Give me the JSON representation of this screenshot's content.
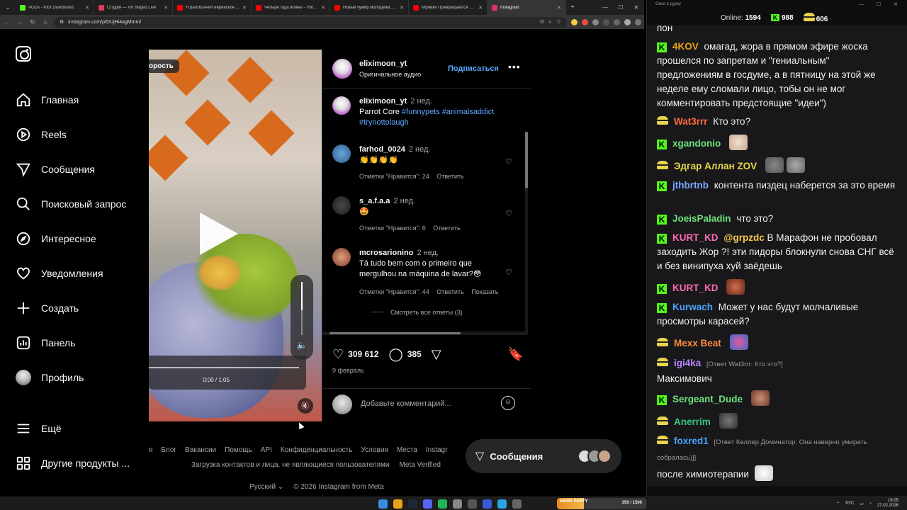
{
  "browser": {
    "tabs": [
      {
        "label": "VODs - Kick Dashboard",
        "color": "#53fc18",
        "active": false
      },
      {
        "label": "Студия — VK Видео Live",
        "color": "#e03a5c",
        "active": false
      },
      {
        "label": "Я разоблачил еврейское ...",
        "color": "#ff0000",
        "active": false
      },
      {
        "label": "Четыре года войны - YouTube",
        "color": "#ff0000",
        "active": false
      },
      {
        "label": "Новый кумир молодежи, ...",
        "color": "#ff0000",
        "active": false
      },
      {
        "label": "Мужики Превращаются в ...",
        "color": "#ff0000",
        "active": false
      },
      {
        "label": "Instagram",
        "color": "#e1306c",
        "active": true
      }
    ],
    "url": "instagram.com/p/DUjHi4agMmm/"
  },
  "ig_nav": {
    "items": [
      {
        "label": "Главная",
        "icon": "home-icon"
      },
      {
        "label": "Reels",
        "icon": "reels-icon"
      },
      {
        "label": "Сообщения",
        "icon": "messages-icon"
      },
      {
        "label": "Поисковый запрос",
        "icon": "search-icon"
      },
      {
        "label": "Интересное",
        "icon": "compass-icon"
      },
      {
        "label": "Уведомления",
        "icon": "heart-icon"
      },
      {
        "label": "Создать",
        "icon": "plus-icon"
      },
      {
        "label": "Панель",
        "icon": "dashboard-icon"
      },
      {
        "label": "Профиль",
        "icon": "avatar"
      }
    ],
    "more": "Ещё",
    "other_products": "Другие продукты ..."
  },
  "video": {
    "label": "орость",
    "time": "0:00 / 1:05"
  },
  "post": {
    "username": "eliximoon_yt",
    "audio": "Оригинальное аудио",
    "follow": "Подписаться",
    "more": "•••",
    "caption": {
      "username": "eliximoon_yt",
      "time": "2 нед.",
      "text": "Parrot Core",
      "tags": "#funnypets #animalsaddict #trynottolaugh"
    },
    "comments": [
      {
        "username": "farhod_0024",
        "time": "2 нед.",
        "text": "👏👏👏👏",
        "likes": "Отметки \"Нравится\": 24",
        "reply": "Ответить",
        "extra": ""
      },
      {
        "username": "s_a.f.a.a",
        "time": "2 нед.",
        "text": "🤩",
        "likes": "Отметки \"Нравится\": 6",
        "reply": "Ответить",
        "extra": ""
      },
      {
        "username": "mcrosarionino",
        "time": "2 нед.",
        "text": "Tá tudo bem com o primeiro que mergulhou na máquina de lavar?😳",
        "likes": "Отметки \"Нравится\": 44",
        "reply": "Ответить",
        "extra": "Показать"
      }
    ],
    "view_replies": "Смотреть все ответы (3)",
    "like_count": "309 612",
    "comment_count": "385",
    "date": "9 февраль",
    "add_comment_placeholder": "Добавьте комментарий..."
  },
  "footer": {
    "links": [
      "я",
      "Блог",
      "Вакансии",
      "Помощь",
      "API",
      "Конфиденциальность",
      "Условия",
      "Места",
      "Instagr"
    ],
    "links2": [
      "Загрузка контактов и лица, не являющиеся пользователями",
      "Meta Verified"
    ],
    "language": "Русский",
    "copyright": "© 2026 Instagram from Meta"
  },
  "messages_pill": {
    "label": "Сообщения"
  },
  "chat": {
    "window_title": "Окно в дурку",
    "online_label": "Online:",
    "online_count": "1594",
    "kick_count": "988",
    "twitch_count": "606",
    "messages": [
      {
        "badge": "",
        "user": "",
        "color": "#efeff1",
        "text": "пон"
      },
      {
        "badge": "kick",
        "user": "4KOV",
        "color": "#e8a317",
        "text": "омагад, жора в прямом эфире жоска прошелся по запретам и \"гениальным\" предложениям в госдуме, а в пятницу на этой же неделе ему сломали лицо, тобы он не мог комментировать предстоящие \"идеи\")"
      },
      {
        "badge": "twitch",
        "user": "Wat3rrr",
        "color": "#ff6b3d",
        "text": "Кто это?"
      },
      {
        "badge": "kick",
        "user": "xgandonio",
        "color": "#6ee07a",
        "text": ""
      },
      {
        "badge": "twitch",
        "user": "Эдгар Аллан ZOV",
        "color": "#e6d84a",
        "text": ""
      },
      {
        "badge": "kick",
        "user": "jthbrtnb",
        "color": "#7aa7ff",
        "text": "контента пиздец наберется за это время"
      },
      {
        "badge": "kick",
        "user": "JoeisPaladin",
        "color": "#6ee07a",
        "text": "что это?"
      },
      {
        "badge": "kick",
        "user": "KURT_KD",
        "color": "#ff6bb5",
        "text": "В Марафон не пробовал заходить Жор ?! эти пидоры блокнули снова СНГ всё и без винипуха хуй заёдешь",
        "mention": "@grpzdc"
      },
      {
        "badge": "kick",
        "user": "KURT_KD",
        "color": "#ff6bb5",
        "text": ""
      },
      {
        "badge": "kick",
        "user": "Kurwach",
        "color": "#4aa3ff",
        "text": "Может у нас будут молчаливые просмотры карасей?"
      },
      {
        "badge": "twitch",
        "user": "Mexx Beat",
        "color": "#ff8a3d",
        "text": ""
      },
      {
        "badge": "twitch",
        "user": "igi4ka",
        "color": "#bb86fc",
        "reply": "[Ответ Wat3rrr: Кто это?]",
        "text": "Максимович"
      },
      {
        "badge": "kick",
        "user": "Sergeant_Dude",
        "color": "#6ee07a",
        "text": ""
      },
      {
        "badge": "twitch",
        "user": "Anerrim",
        "color": "#3ac47d",
        "text": ""
      },
      {
        "badge": "twitch",
        "user": "foxred1",
        "color": "#4aa3ff",
        "reply": "[Ответ Келлер Доминатор: Она наверно умирать собралась)]]",
        "text": "после химиотерапии"
      }
    ]
  },
  "taskbar": {
    "widget_label": "MEME PARTY",
    "widget_value": "350 / 1500",
    "lang": "РУС",
    "time": "16:05",
    "date": "27.02.2026"
  }
}
